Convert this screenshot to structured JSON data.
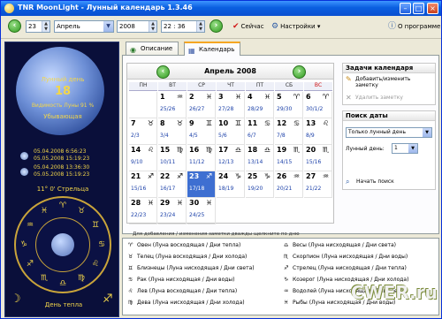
{
  "window": {
    "title": "TNR MoonLight - Лунный календарь 1.3.46"
  },
  "toolbar": {
    "day": "23",
    "month": "Апрель",
    "year": "2008",
    "time": "22 : 36",
    "now_label": "Сейчас",
    "settings_label": "Настройки",
    "about_label": "О программе"
  },
  "moon_panel": {
    "lunar_day": "Лунный день",
    "day_number": "18",
    "visibility": "Видимость Луны 91 %",
    "phase": "Убывающая",
    "moonrise": [
      "05.04.2008 6:56:23",
      "05.05.2008 15:19:23"
    ],
    "moonset": [
      "05.04.2008 13:36:30",
      "05.05.2008 15:19:23"
    ],
    "zodiac_position": "11° 0' Стрельца",
    "day_type": "День тепла"
  },
  "tabs": [
    {
      "label": "Описание"
    },
    {
      "label": "Календарь"
    }
  ],
  "calendar": {
    "title": "Апрель 2008",
    "weekdays": [
      "ПН",
      "ВТ",
      "СР",
      "ЧТ",
      "ПТ",
      "СБ",
      "ВС"
    ],
    "note": "Для добавления / изменения заметки дважды щелкните по дню",
    "cells": [
      {
        "day": "",
        "sign": "",
        "lunar": ""
      },
      {
        "day": "1",
        "sign": "♒",
        "lunar": "25/26"
      },
      {
        "day": "2",
        "sign": "♓",
        "lunar": "26/27"
      },
      {
        "day": "3",
        "sign": "♓",
        "lunar": "27/28"
      },
      {
        "day": "4",
        "sign": "♓",
        "lunar": "28/29"
      },
      {
        "day": "5",
        "sign": "♈",
        "lunar": "29/30"
      },
      {
        "day": "6",
        "sign": "♈",
        "lunar": "30/1/2"
      },
      {
        "day": "7",
        "sign": "♉",
        "lunar": "2/3"
      },
      {
        "day": "8",
        "sign": "♉",
        "lunar": "3/4"
      },
      {
        "day": "9",
        "sign": "♊",
        "lunar": "4/5"
      },
      {
        "day": "10",
        "sign": "♊",
        "lunar": "5/6"
      },
      {
        "day": "11",
        "sign": "♋",
        "lunar": "6/7"
      },
      {
        "day": "12",
        "sign": "♋",
        "lunar": "7/8"
      },
      {
        "day": "13",
        "sign": "♌",
        "lunar": "8/9"
      },
      {
        "day": "14",
        "sign": "♌",
        "lunar": "9/10"
      },
      {
        "day": "15",
        "sign": "♍",
        "lunar": "10/11"
      },
      {
        "day": "16",
        "sign": "♍",
        "lunar": "11/12"
      },
      {
        "day": "17",
        "sign": "♎",
        "lunar": "12/13"
      },
      {
        "day": "18",
        "sign": "♎",
        "lunar": "13/14"
      },
      {
        "day": "19",
        "sign": "♏",
        "lunar": "14/15"
      },
      {
        "day": "20",
        "sign": "♏",
        "lunar": "15/16"
      },
      {
        "day": "21",
        "sign": "♐",
        "lunar": "15/16"
      },
      {
        "day": "22",
        "sign": "♐",
        "lunar": "16/17"
      },
      {
        "day": "23",
        "sign": "♐",
        "lunar": "17/18"
      },
      {
        "day": "24",
        "sign": "♑",
        "lunar": "18/19"
      },
      {
        "day": "25",
        "sign": "♑",
        "lunar": "19/20"
      },
      {
        "day": "26",
        "sign": "♒",
        "lunar": "20/21"
      },
      {
        "day": "27",
        "sign": "♒",
        "lunar": "21/22"
      },
      {
        "day": "28",
        "sign": "♓",
        "lunar": "22/23"
      },
      {
        "day": "29",
        "sign": "♓",
        "lunar": "23/24"
      },
      {
        "day": "30",
        "sign": "♓",
        "lunar": "24/25"
      }
    ]
  },
  "tasks": {
    "title": "Задачи календаря",
    "add_note": "Добавить/изменить заметку",
    "delete_note": "Удалить заметку"
  },
  "search": {
    "title": "Поиск даты",
    "mode": "Только лунный день",
    "lunar_day_label": "Лунный день:",
    "lunar_day_value": "1",
    "start": "Начать поиск"
  },
  "legend": [
    {
      "sym": "♈",
      "text": "Овен (Луна восходящая / Дни тепла)"
    },
    {
      "sym": "♉",
      "text": "Телец (Луна восходящая / Дни холода)"
    },
    {
      "sym": "♊",
      "text": "Близнецы (Луна нисходящая / Дни света)"
    },
    {
      "sym": "♋",
      "text": "Рак (Луна нисходящая / Дни воды)"
    },
    {
      "sym": "♌",
      "text": "Лев (Луна восходящая / Дни тепла)"
    },
    {
      "sym": "♍",
      "text": "Дева (Луна нисходящая / Дни холода)"
    },
    {
      "sym": "♎",
      "text": "Весы (Луна нисходящая / Дни света)"
    },
    {
      "sym": "♏",
      "text": "Скорпион (Луна нисходящая / Дни воды)"
    },
    {
      "sym": "♐",
      "text": "Стрелец (Луна нисходящая / Дни тепла)"
    },
    {
      "sym": "♑",
      "text": "Козерог (Луна нисходящая / Дни холода)"
    },
    {
      "sym": "♒",
      "text": "Водолей (Луна нисходящая / Дни света)"
    },
    {
      "sym": "♓",
      "text": "Рыбы (Луна нисходящая / Дни воды)"
    }
  ],
  "zodiac_wheel": [
    "♈",
    "♉",
    "♊",
    "♋",
    "♌",
    "♍",
    "♎",
    "♏",
    "♐",
    "♑",
    "♒",
    "♓"
  ],
  "watermark": "CWER.ru"
}
